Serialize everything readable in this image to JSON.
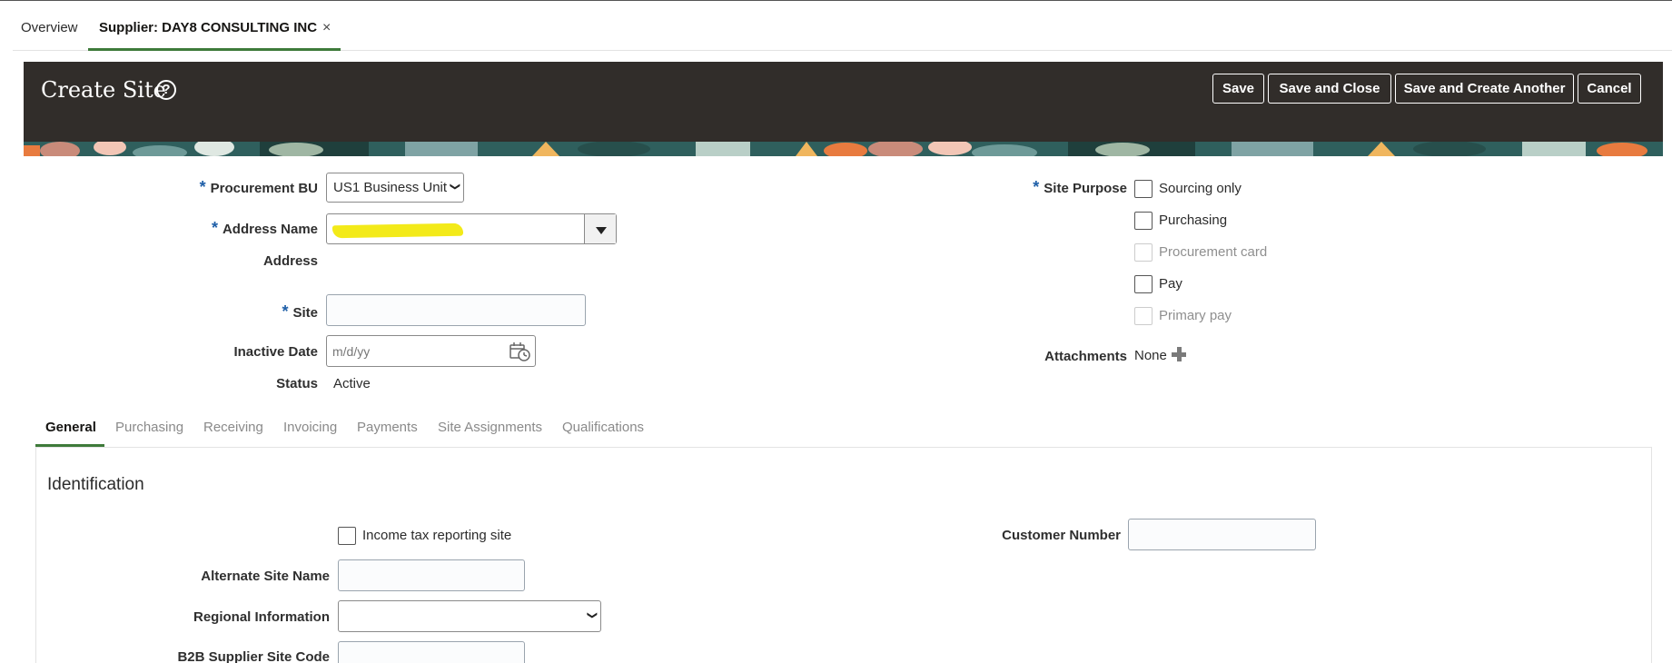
{
  "tabs": {
    "overview": "Overview",
    "supplier": "Supplier: DAY8 CONSULTING INC",
    "close": "×"
  },
  "header": {
    "title": "Create Site",
    "help": "?",
    "buttons": {
      "save": "Save",
      "save_and_close": "Save and Close",
      "save_and_create_another": "Save and Create Another",
      "cancel": "Cancel"
    }
  },
  "form": {
    "required_mark": "*",
    "procurement_bu": {
      "label": "Procurement BU",
      "value": "US1 Business Unit"
    },
    "address_name": {
      "label": "Address Name",
      "value": ""
    },
    "address": {
      "label": "Address"
    },
    "site": {
      "label": "Site",
      "value": ""
    },
    "inactive_date": {
      "label": "Inactive Date",
      "placeholder": "m/d/yy"
    },
    "status": {
      "label": "Status",
      "value": "Active"
    },
    "site_purpose": {
      "label": "Site Purpose",
      "options": [
        {
          "label": "Sourcing only",
          "checked": false,
          "disabled": false
        },
        {
          "label": "Purchasing",
          "checked": false,
          "disabled": false
        },
        {
          "label": "Procurement card",
          "checked": false,
          "disabled": true
        },
        {
          "label": "Pay",
          "checked": false,
          "disabled": false
        },
        {
          "label": "Primary pay",
          "checked": false,
          "disabled": true
        }
      ]
    },
    "attachments": {
      "label": "Attachments",
      "value": "None"
    }
  },
  "subtabs": [
    "General",
    "Purchasing",
    "Receiving",
    "Invoicing",
    "Payments",
    "Site Assignments",
    "Qualifications"
  ],
  "identification": {
    "title": "Identification",
    "income_tax": "Income tax reporting site",
    "customer_number": {
      "label": "Customer Number",
      "value": ""
    },
    "alternate_site_name": {
      "label": "Alternate Site Name",
      "value": ""
    },
    "regional_information": {
      "label": "Regional Information",
      "value": ""
    },
    "b2b_code": {
      "label": "B2B Supplier Site Code",
      "value": ""
    }
  },
  "colors": {
    "header_bg": "#312d2a",
    "accent_green": "#3e7a3a",
    "required_blue": "#1f5fa8"
  }
}
